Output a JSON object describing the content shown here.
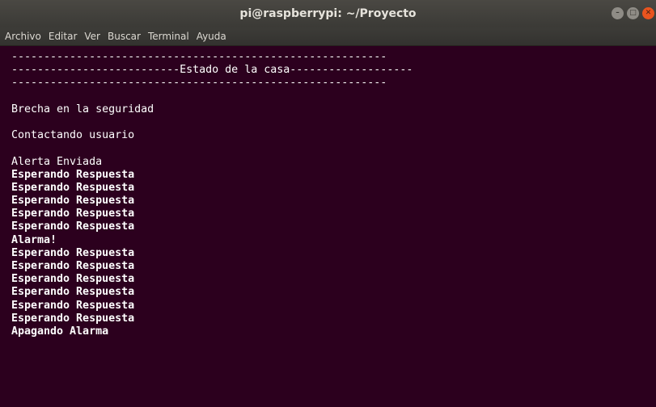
{
  "window": {
    "title": "pi@raspberrypi: ~/Proyecto"
  },
  "menu": [
    "Archivo",
    "Editar",
    "Ver",
    "Buscar",
    "Terminal",
    "Ayuda"
  ],
  "terminal": {
    "lines": [
      {
        "text": "----------------------------------------------------------",
        "bold": false
      },
      {
        "text": "--------------------------Estado de la casa-------------------",
        "bold": false
      },
      {
        "text": "----------------------------------------------------------",
        "bold": false
      },
      {
        "text": "",
        "bold": false
      },
      {
        "text": "Brecha en la seguridad",
        "bold": false
      },
      {
        "text": "",
        "bold": false
      },
      {
        "text": "Contactando usuario",
        "bold": false
      },
      {
        "text": "",
        "bold": false
      },
      {
        "text": "Alerta Enviada",
        "bold": false
      },
      {
        "text": "Esperando Respuesta",
        "bold": true
      },
      {
        "text": "Esperando Respuesta",
        "bold": true
      },
      {
        "text": "Esperando Respuesta",
        "bold": true
      },
      {
        "text": "Esperando Respuesta",
        "bold": true
      },
      {
        "text": "Esperando Respuesta",
        "bold": true
      },
      {
        "text": "Alarma!",
        "bold": true
      },
      {
        "text": "Esperando Respuesta",
        "bold": true
      },
      {
        "text": "Esperando Respuesta",
        "bold": true
      },
      {
        "text": "Esperando Respuesta",
        "bold": true
      },
      {
        "text": "Esperando Respuesta",
        "bold": true
      },
      {
        "text": "Esperando Respuesta",
        "bold": true
      },
      {
        "text": "Esperando Respuesta",
        "bold": true
      },
      {
        "text": "Apagando Alarma",
        "bold": true
      }
    ]
  },
  "colors": {
    "terminal_bg": "#2c001e",
    "text": "#ffffff",
    "close_button": "#e9541f"
  }
}
